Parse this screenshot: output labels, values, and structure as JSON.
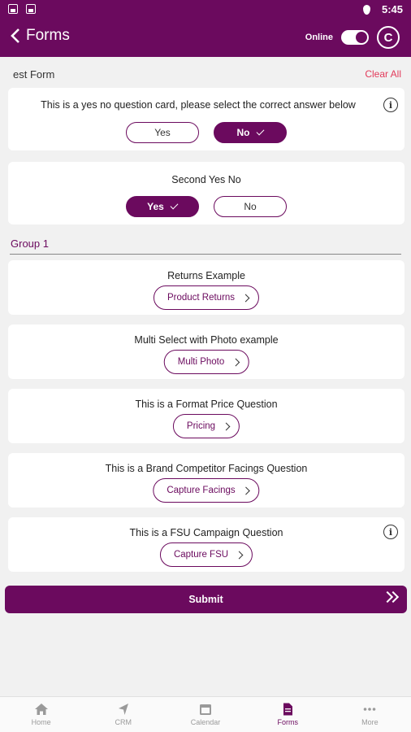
{
  "status_bar": {
    "time": "5:45"
  },
  "app_bar": {
    "title": "Forms",
    "online_label": "Online",
    "avatar_letter": "C"
  },
  "form": {
    "name": "est Form",
    "clear_all": "Clear All"
  },
  "yes_no_cards": [
    {
      "question": "This is a yes no question card, please select the correct answer below",
      "yes_label": "Yes",
      "no_label": "No",
      "selected": "No",
      "has_info": true
    },
    {
      "question": "Second Yes No",
      "yes_label": "Yes",
      "no_label": "No",
      "selected": "Yes",
      "has_info": false
    }
  ],
  "group": {
    "label": "Group 1"
  },
  "action_cards": [
    {
      "question": "Returns Example",
      "button": "Product Returns"
    },
    {
      "question": "Multi Select with Photo example",
      "button": "Multi Photo"
    },
    {
      "question": "This is a Format Price Question",
      "button": "Pricing"
    },
    {
      "question": "This is a Brand Competitor Facings Question",
      "button": "Capture Facings"
    },
    {
      "question": "This is a FSU Campaign Question",
      "button": "Capture FSU"
    }
  ],
  "submit_label": "Submit",
  "bottom_nav": [
    {
      "label": "Home",
      "icon": "home-icon"
    },
    {
      "label": "CRM",
      "icon": "navigation-arrow-icon"
    },
    {
      "label": "Calendar",
      "icon": "calendar-icon"
    },
    {
      "label": "Forms",
      "icon": "document-icon",
      "active": true
    },
    {
      "label": "More",
      "icon": "more-dots-icon"
    }
  ],
  "colors": {
    "brand": "#6b0a5e",
    "clear_all": "#e23a5a",
    "background": "#f1f1f1"
  }
}
